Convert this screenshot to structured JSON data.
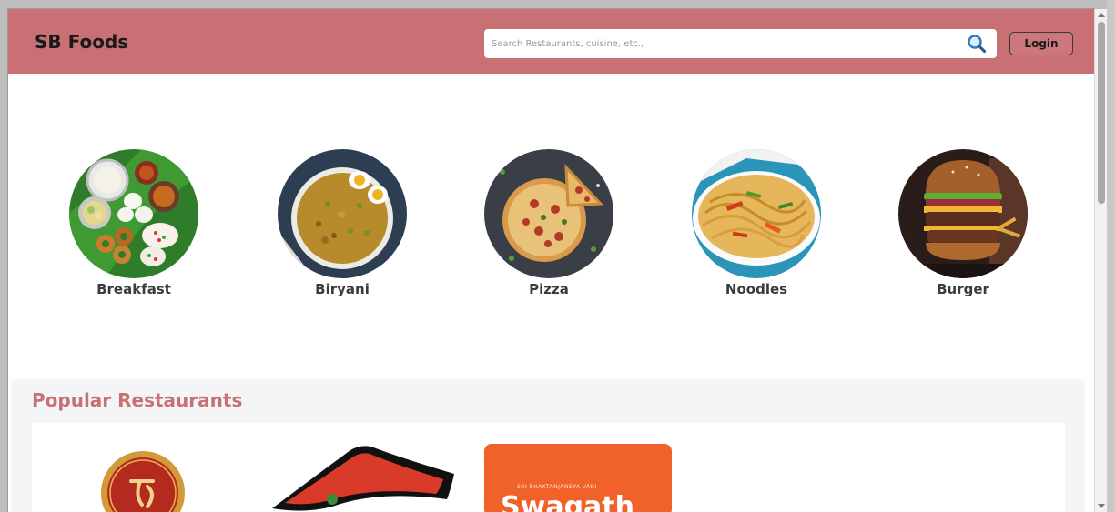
{
  "header": {
    "brand": "SB Foods",
    "search_placeholder": "Search Restaurants, cuisine, etc.,",
    "search_value": "",
    "login_label": "Login"
  },
  "categories": [
    {
      "label": "Breakfast",
      "icon": "breakfast-image"
    },
    {
      "label": "Biryani",
      "icon": "biryani-image"
    },
    {
      "label": "Pizza",
      "icon": "pizza-image"
    },
    {
      "label": "Noodles",
      "icon": "noodles-image"
    },
    {
      "label": "Burger",
      "icon": "burger-image"
    }
  ],
  "popular": {
    "title": "Popular Restaurants",
    "restaurants": [
      {
        "logo": "round-emblem-logo"
      },
      {
        "logo": "red-roof-logo"
      },
      {
        "logo": "orange-square-logo",
        "tagline": "SRI BHAKTANJANEYA VARI",
        "wordmark": "Swagath"
      }
    ]
  },
  "colors": {
    "header_bg": "#c87074",
    "accent": "#c87074",
    "section_bg": "#f4f5f7"
  }
}
